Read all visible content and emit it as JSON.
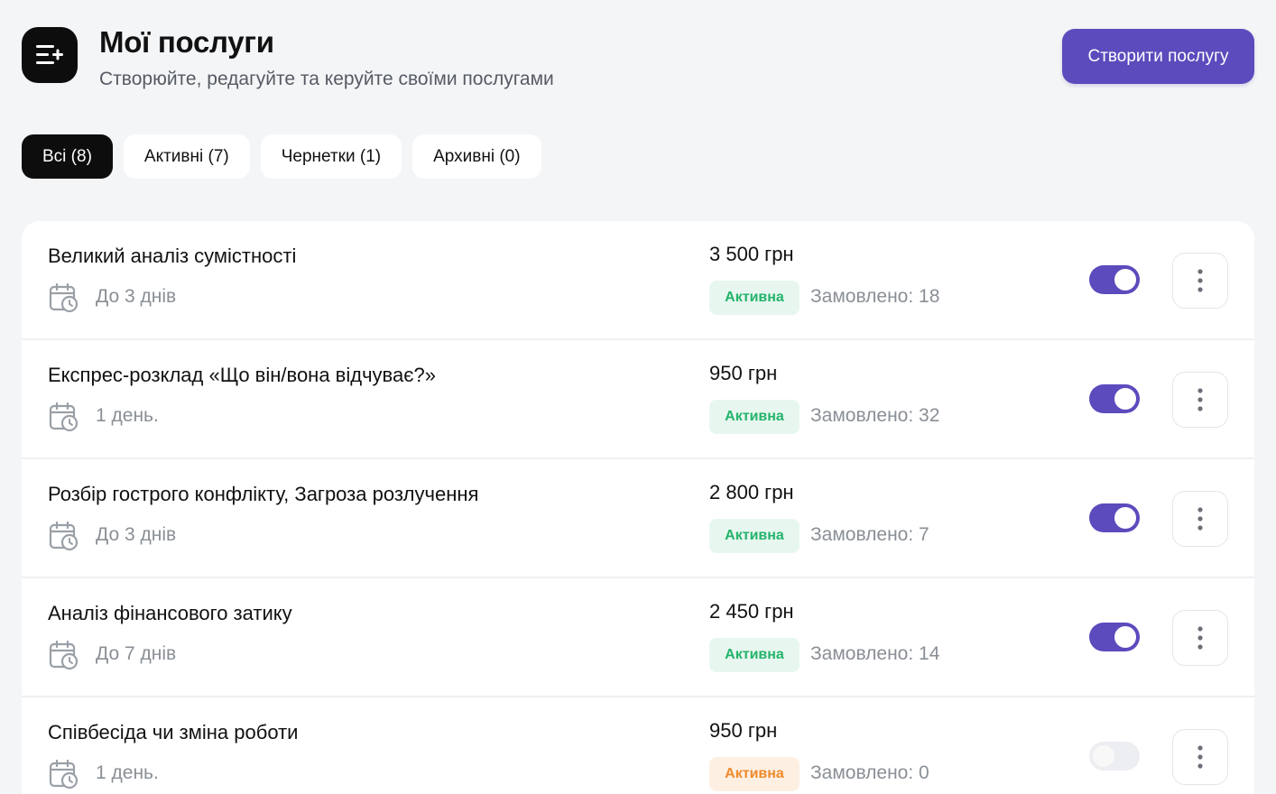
{
  "header": {
    "title": "Мої послуги",
    "subtitle": "Створюйте, редагуйте та керуйте своїми послугами",
    "create_label": "Створити послугу",
    "icon": "list-add-icon"
  },
  "tabs": [
    {
      "label": "Всі (8)",
      "active": true
    },
    {
      "label": "Активні (7)",
      "active": false
    },
    {
      "label": "Чернетки (1)",
      "active": false
    },
    {
      "label": "Архивні (0)",
      "active": false
    }
  ],
  "colors": {
    "accent": "#5b4bbd",
    "active_badge_green": "#25b36c",
    "active_badge_orange": "#ef8a2a"
  },
  "services": [
    {
      "name": "Великий аналіз сумістності",
      "duration": "До 3 днів",
      "price": "3 500 грн",
      "status": "Активна",
      "status_color": "green",
      "ordered": "Замовлено: 18",
      "enabled": true
    },
    {
      "name": "Експрес-розклад «Що він/вона відчуває?»",
      "duration": "1 день.",
      "price": "950 грн",
      "status": "Активна",
      "status_color": "green",
      "ordered": "Замовлено: 32",
      "enabled": true
    },
    {
      "name": "Розбір гострого конфлікту, Загроза розлучення",
      "duration": "До 3 днів",
      "price": "2 800 грн",
      "status": "Активна",
      "status_color": "green",
      "ordered": "Замовлено: 7",
      "enabled": true
    },
    {
      "name": "Аналіз фінансового затику",
      "duration": "До 7 днів",
      "price": "2 450 грн",
      "status": "Активна",
      "status_color": "green",
      "ordered": "Замовлено: 14",
      "enabled": true
    },
    {
      "name": "Співбесіда чи зміна роботи",
      "duration": "1 день.",
      "price": "950 грн",
      "status": "Активна",
      "status_color": "orange",
      "ordered": "Замовлено: 0",
      "enabled": false
    }
  ]
}
